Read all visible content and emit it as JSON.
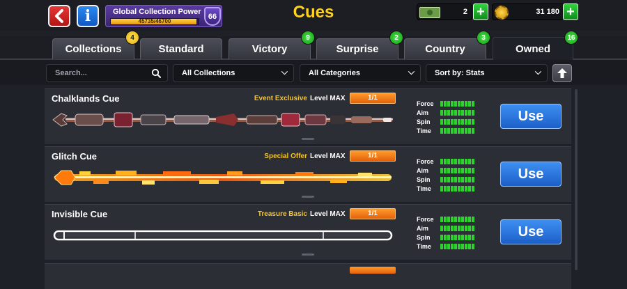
{
  "header": {
    "title": "Cues",
    "collection_power": {
      "label": "Global Collection Power",
      "value_text": "45735/46700",
      "progress": 0.979,
      "level": "66"
    },
    "cash": "2",
    "coins": "31 180"
  },
  "tabs": [
    {
      "label": "Collections",
      "badge": "4",
      "badge_color": "yellow",
      "active": false
    },
    {
      "label": "Standard",
      "badge": "",
      "badge_color": "",
      "active": false
    },
    {
      "label": "Victory",
      "badge": "9",
      "badge_color": "green",
      "active": false
    },
    {
      "label": "Surprise",
      "badge": "2",
      "badge_color": "green",
      "active": false
    },
    {
      "label": "Country",
      "badge": "3",
      "badge_color": "green",
      "active": false
    },
    {
      "label": "Owned",
      "badge": "16",
      "badge_color": "green",
      "active": true
    }
  ],
  "filters": {
    "search_placeholder": "Search...",
    "collections": "All Collections",
    "categories": "All Categories",
    "sort": "Sort by: Stats"
  },
  "stat_labels": [
    "Force",
    "Aim",
    "Spin",
    "Time"
  ],
  "cues": [
    {
      "name": "Chalklands Cue",
      "source": "Event Exclusive",
      "level_label": "Level MAX",
      "level_progress": "1/1",
      "style": "chalklands",
      "stats": {
        "Force": 10,
        "Aim": 10,
        "Spin": 10,
        "Time": 10
      },
      "button": "Use"
    },
    {
      "name": "Glitch Cue",
      "source": "Special Offer",
      "level_label": "Level MAX",
      "level_progress": "1/1",
      "style": "glitch",
      "stats": {
        "Force": 10,
        "Aim": 10,
        "Spin": 10,
        "Time": 10
      },
      "button": "Use"
    },
    {
      "name": "Invisible Cue",
      "source": "Treasure Basic",
      "level_label": "Level MAX",
      "level_progress": "1/1",
      "style": "invisible",
      "stats": {
        "Force": 10,
        "Aim": 10,
        "Spin": 10,
        "Time": 10
      },
      "button": "Use"
    }
  ],
  "colors": {
    "background": "#1f2128",
    "card": "#2c2e35",
    "title_yellow": "#ffd21f",
    "use_button_blue": "#2a7be0",
    "level_orange": "#f07a18",
    "stat_green": "#2fd12f",
    "source_yellow": "#f5c32a"
  }
}
